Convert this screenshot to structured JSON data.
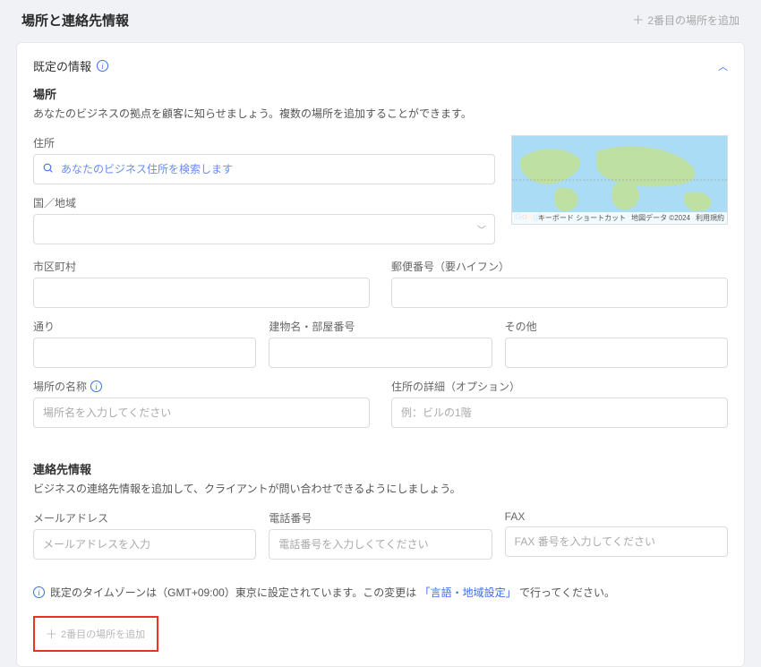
{
  "pageTitle": "場所と連絡先情報",
  "addSecondTop": "2番目の場所を追加",
  "card": {
    "header": "既定の情報",
    "location": {
      "heading": "場所",
      "desc": "あなたのビジネスの拠点を顧客に知らせましょう。複数の場所を追加することができます。",
      "addressLabel": "住所",
      "addressPh": "あなたのビジネス住所を検索します",
      "countryLabel": "国／地域",
      "cityLabel": "市区町村",
      "postalLabel": "郵便番号（要ハイフン）",
      "streetLabel": "通り",
      "buildingLabel": "建物名・部屋番号",
      "otherLabel": "その他",
      "nameLabel": "場所の名称",
      "namePh": "場所名を入力してください",
      "detailLabel": "住所の詳細（オプション）",
      "detailPh": "例：ビルの1階"
    },
    "contact": {
      "heading": "連絡先情報",
      "desc": "ビジネスの連絡先情報を追加して、クライアントが問い合わせできるようにしましょう。",
      "emailLabel": "メールアドレス",
      "emailPh": "メールアドレスを入力",
      "phoneLabel": "電話番号",
      "phonePh": "電話番号を入力しくてください",
      "faxLabel": "FAX",
      "faxPh": "FAX 番号を入力してください"
    },
    "tz": {
      "prefix": "既定のタイムゾーンは（GMT+09:00）東京に設定されています。この変更は",
      "link": "「言語・地域設定」",
      "suffix": "で行ってください。"
    },
    "map": {
      "shortcuts": "キーボード ショートカット",
      "mapdata": "地図データ ©2024",
      "terms": "利用規約"
    }
  },
  "addSecondBottom": "2番目の場所を追加"
}
